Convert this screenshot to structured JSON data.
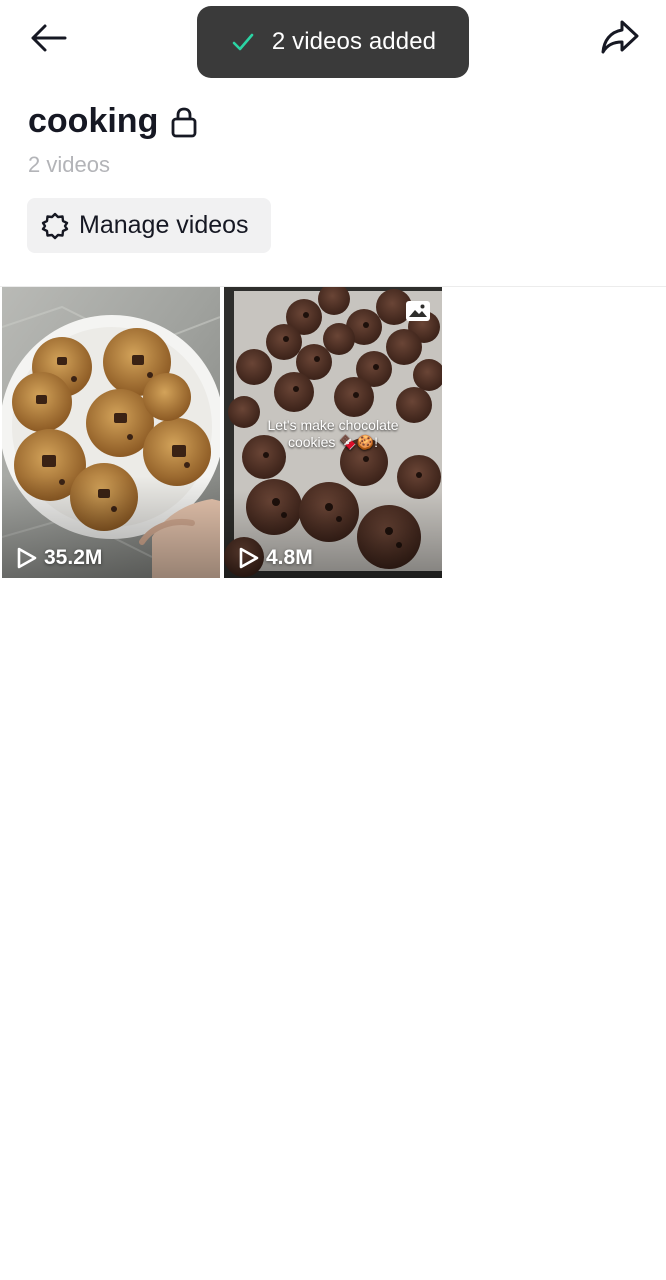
{
  "toast": {
    "text": "2 videos added",
    "check_color": "#2bd4a4"
  },
  "collection": {
    "title": "cooking",
    "video_count": "2 videos",
    "private": true
  },
  "manage": {
    "label": "Manage videos"
  },
  "videos": [
    {
      "views": "35.2M",
      "caption": ""
    },
    {
      "views": "4.8M",
      "caption_line1": "Let's make chocolate",
      "caption_line2": "cookies 🍫🍪!",
      "photo_mode": true
    }
  ],
  "icons": {
    "back": "arrow-left-icon",
    "share": "share-arrow-icon",
    "lock": "lock-icon",
    "manage": "gear-icon",
    "play": "play-icon",
    "photo": "photo-icon"
  }
}
